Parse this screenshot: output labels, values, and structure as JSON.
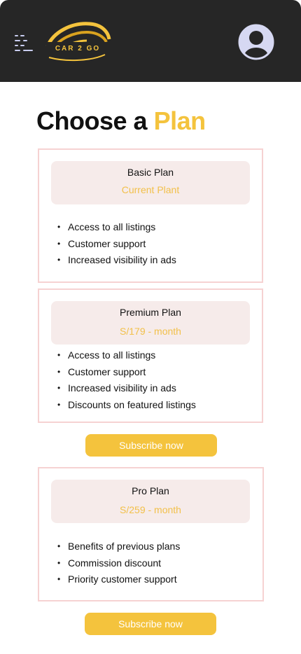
{
  "header": {
    "logo_text": "CAR 2 GO"
  },
  "page": {
    "title_main": "Choose a",
    "title_accent": "Plan"
  },
  "plans": [
    {
      "name": "Basic Plan",
      "price": "Current Plant",
      "features": [
        "Access to all listings",
        "Customer support",
        "Increased visibility in ads"
      ]
    },
    {
      "name": "Premium Plan",
      "price": "S/179 - month",
      "features": [
        "Access to all listings",
        "Customer support",
        "Increased visibility in ads",
        "Discounts on featured listings"
      ],
      "button_label": "Subscribe now"
    },
    {
      "name": "Pro Plan",
      "price": "S/259 - month",
      "features": [
        "Benefits of previous plans",
        "Commission discount",
        "Priority customer support"
      ],
      "button_label": "Subscribe now"
    }
  ],
  "colors": {
    "accent": "#f4c33d",
    "header_bg": "#262626",
    "card_border": "#f6d2d2",
    "card_head_bg": "#f6ebea",
    "avatar": "#d6d8f2"
  },
  "icons": {
    "menu": "menu-icon",
    "avatar": "user-avatar-icon"
  }
}
